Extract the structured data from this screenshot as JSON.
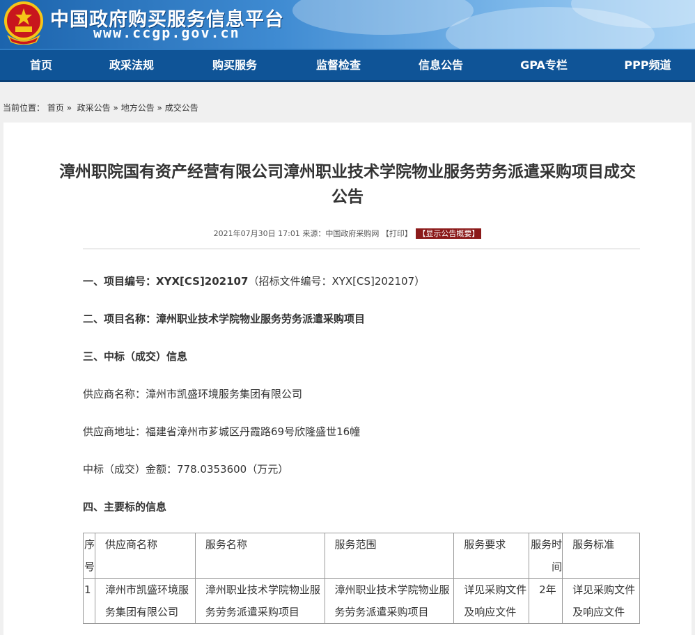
{
  "header": {
    "site_name": "中国政府购买服务信息平台",
    "domain": "www.ccgp.gov.cn"
  },
  "nav": {
    "items": [
      {
        "label": "首页"
      },
      {
        "label": "政采法规"
      },
      {
        "label": "购买服务"
      },
      {
        "label": "监督检查"
      },
      {
        "label": "信息公告"
      },
      {
        "label": "GPA专栏"
      },
      {
        "label": "PPP频道"
      }
    ]
  },
  "breadcrumb": {
    "prefix": "当前位置：",
    "items": [
      "首页",
      "政采公告",
      "地方公告",
      "成交公告"
    ],
    "separator": "»"
  },
  "article": {
    "title_line1": "漳州职院国有资产经营有限公司漳州职业技术学院物业服务劳务派遣采购项目成交",
    "title_line2": "公告",
    "date": "2021年07月30日 17:01",
    "source_label": "来源：",
    "source": "中国政府采购网",
    "print_label": "【打印】",
    "summary_button": "【显示公告概要】",
    "sections": {
      "s1_label": "一、项目编号：",
      "s1_value": "XYX[CS]202107",
      "s1_note": "（招标文件编号：XYX[CS]202107）",
      "s2_label": "二、项目名称：",
      "s2_value": "漳州职业技术学院物业服务劳务派遣采购项目",
      "s3_label": "三、中标（成交）信息",
      "supplier_name_line": "供应商名称：漳州市凯盛环境服务集团有限公司",
      "supplier_addr_line": "供应商地址：福建省漳州市芗城区丹霞路69号欣隆盛世16幢",
      "amount_line": "中标（成交）金额：778.0353600（万元）",
      "s4_label": "四、主要标的信息"
    },
    "table": {
      "headers": [
        "序号",
        "供应商名称",
        "服务名称",
        "服务范围",
        "服务要求",
        "服务时间",
        "服务标准"
      ],
      "rows": [
        [
          "1",
          "漳州市凯盛环境服务集团有限公司",
          "漳州职业技术学院物业服务劳务派遣采购项目",
          "漳州职业技术学院物业服务劳务派遣采购项目",
          "详见采购文件及响应文件",
          "2年",
          "详见采购文件及响应文件"
        ]
      ]
    }
  }
}
